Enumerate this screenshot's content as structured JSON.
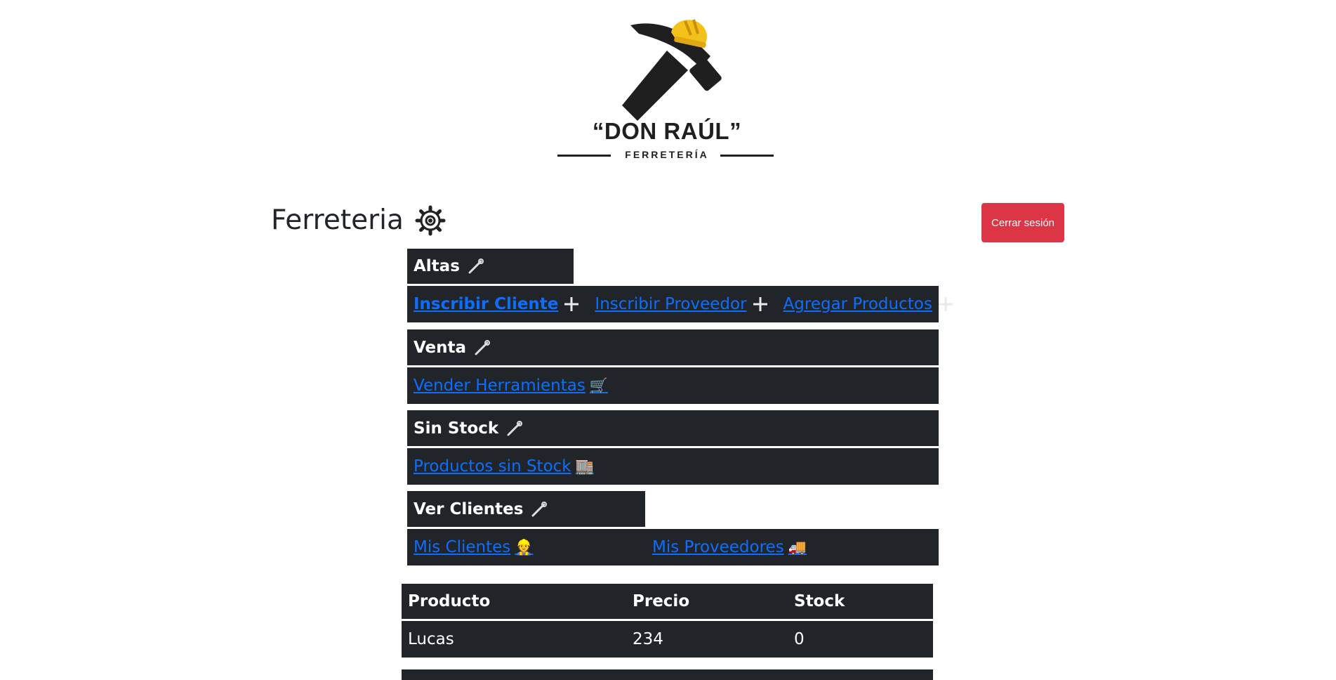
{
  "logo": {
    "title": "“DON RAÚL”",
    "subtitle": "FERRETERÍA",
    "icon": "hammer-with-hardhat-icon"
  },
  "header": {
    "title": "Ferreteria",
    "title_icon": "gear-icon",
    "logout_label": "Cerrar sesión",
    "logout_color": "#dc3545"
  },
  "sections": {
    "altas": {
      "label": "Altas",
      "links": [
        "Inscribir Cliente",
        "Inscribir Proveedor",
        "Agregar Productos"
      ]
    },
    "venta": {
      "label": "Venta",
      "link": "Vender Herramientas",
      "link_icon": "🛒"
    },
    "sin_stock": {
      "label": "Sin Stock",
      "link": "Productos sin Stock",
      "link_icon": "🏬"
    },
    "ver_clientes": {
      "label": "Ver Clientes",
      "links": [
        "Mis Clientes",
        "Mis Proveedores"
      ],
      "link_icons": [
        "👷",
        "🚚"
      ]
    }
  },
  "table": {
    "columns": [
      "Producto",
      "Precio",
      "Stock"
    ],
    "rows": [
      [
        "Lucas",
        "234",
        "0"
      ]
    ]
  },
  "colors": {
    "panel_bg": "#212529",
    "link": "#0d6efd",
    "danger": "#dc3545"
  }
}
